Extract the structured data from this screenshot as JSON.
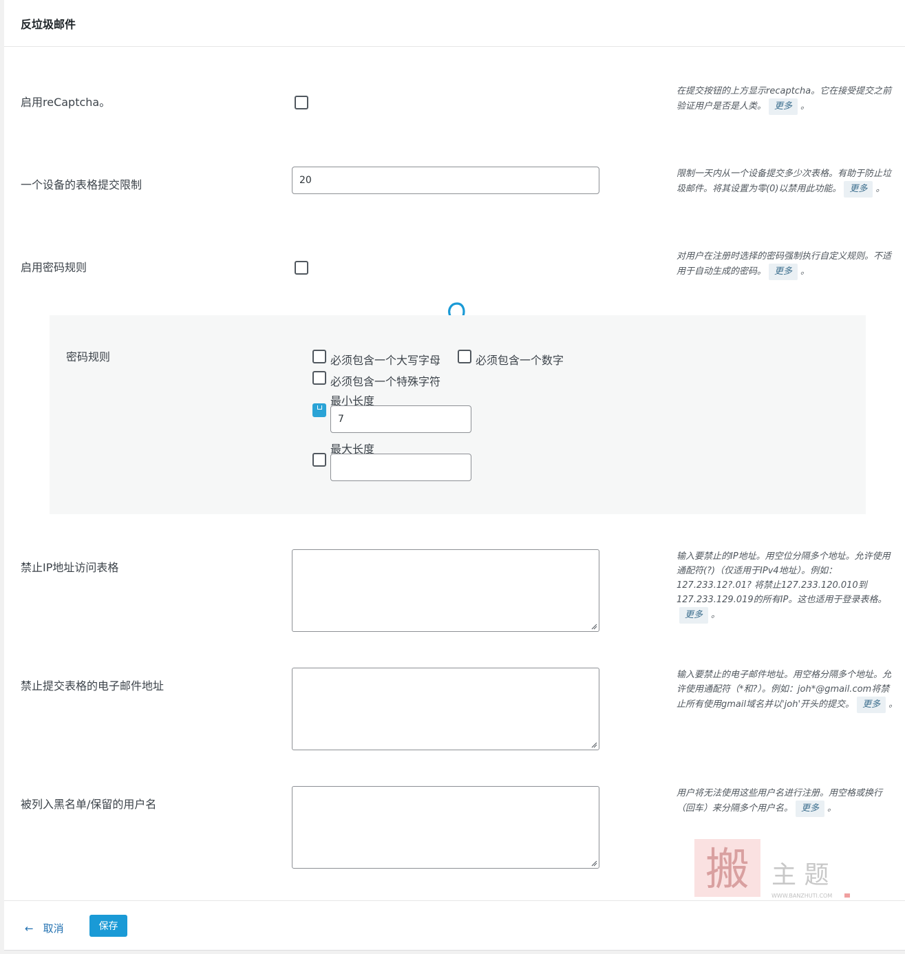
{
  "header": {
    "title": "反垃圾邮件"
  },
  "rows": {
    "recaptcha": {
      "label": "启用reCaptcha。",
      "checked": false,
      "help": "在提交按钮的上方显示recaptcha。它在接受提交之前验证用户是否是人类。",
      "more": "更多",
      "tail": "。"
    },
    "submit_limit": {
      "label": "一个设备的表格提交限制",
      "value": "20",
      "help": "限制一天内从一个设备提交多少次表格。有助于防止垃圾邮件。将其设置为零(0)以禁用此功能。",
      "more": "更多",
      "tail": "。"
    },
    "password_rules_toggle": {
      "label": "启用密码规则",
      "checked": false,
      "help": "对用户在注册时选择的密码强制执行自定义规则。不适用于自动生成的密码。",
      "more": "更多",
      "tail": "。"
    },
    "banned_ips": {
      "label": "禁止IP地址访问表格",
      "value": "",
      "help": "输入要禁止的IP地址。用空位分隔多个地址。允许使用通配符(?)（仅适用于IPv4地址）。例如：127.233.12?.01? 将禁止127.233.120.010到127.233.129.019的所有IP。这也适用于登录表格。",
      "more": "更多",
      "tail": "。"
    },
    "banned_emails": {
      "label": "禁止提交表格的电子邮件地址",
      "value": "",
      "help": "输入要禁止的电子邮件地址。用空格分隔多个地址。允许使用通配符（*和?）。例如：joh*@gmail.com将禁止所有使用gmail域名并以'joh'开头的提交。",
      "more": "更多",
      "tail": "。"
    },
    "blacklisted_usernames": {
      "label": "被列入黑名单/保留的用户名",
      "value": "",
      "help": "用户将无法使用这些用户名进行注册。用空格或换行（回车）来分隔多个用户名。",
      "more": "更多",
      "tail": "。"
    }
  },
  "password_rules": {
    "label": "密码规则",
    "uppercase": {
      "label": "必须包含一个大写字母",
      "checked": false
    },
    "number": {
      "label": "必须包含一个数字",
      "checked": false
    },
    "special": {
      "label": "必须包含一个特殊字符",
      "checked": false
    },
    "min_length": {
      "label": "最小长度",
      "checked": true,
      "value": "7"
    },
    "max_length": {
      "label": "最大长度",
      "checked": false,
      "value": ""
    }
  },
  "footer": {
    "cancel_arrow": "←",
    "cancel_label": "取消",
    "save_label": "保存"
  },
  "watermark": {
    "char": "搬",
    "text": "主 题",
    "url": "WWW.BANZHUTI.COM"
  },
  "colors": {
    "accent": "#1a9ad6",
    "arrow": "#1a9ad6",
    "panel_bg": "#ffffff",
    "sub_bg": "#f6f7f7",
    "link": "#2271b1"
  }
}
